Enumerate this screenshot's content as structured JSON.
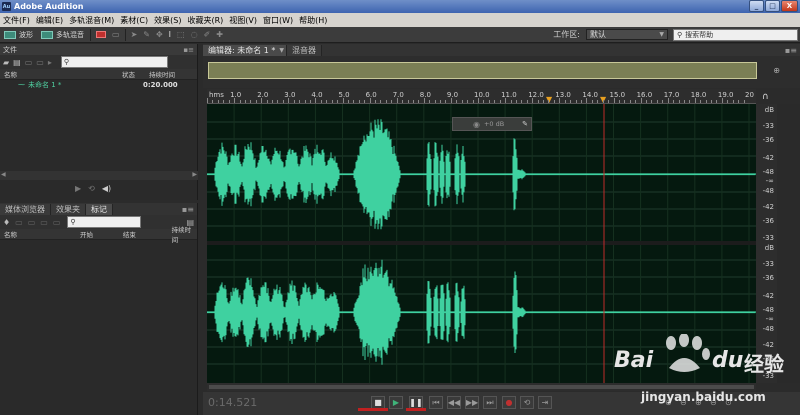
{
  "titlebar": {
    "title": "Adobe Audition",
    "logo": "Au"
  },
  "window_controls": {
    "minimize": "_",
    "maximize": "□",
    "close": "X"
  },
  "menu": [
    "文件(F)",
    "编辑(E)",
    "多轨混音(M)",
    "素材(C)",
    "效果(S)",
    "收藏夹(R)",
    "视图(V)",
    "窗口(W)",
    "帮助(H)"
  ],
  "toolbar": {
    "waveform_label": "波形",
    "multitrack_label": "多轨混音",
    "workspace_label": "工作区:",
    "workspace_value": "默认",
    "search_placeholder": "搜索帮助"
  },
  "files_panel": {
    "title": "文件",
    "columns": [
      "名称",
      "状态",
      "持续时间"
    ],
    "rows": [
      {
        "name": "未命名 1 *",
        "duration": "0:20.000"
      }
    ]
  },
  "markers_panel": {
    "tabs": [
      "媒体浏览器",
      "效果夹",
      "标记"
    ],
    "active_tab": "标记",
    "columns": [
      "名称",
      "开始",
      "结束",
      "持续时间"
    ]
  },
  "editor": {
    "tabs": [
      "编辑器: 未命名 1 *",
      "混音器"
    ],
    "active_tab": "编辑器: 未命名 1 *",
    "ruler_unit": "hms",
    "ruler_ticks": [
      "1.0",
      "2.0",
      "3.0",
      "4.0",
      "5.0",
      "6.0",
      "7.0",
      "8.0",
      "9.0",
      "10.0",
      "11.0",
      "12.0",
      "13.0",
      "14.0",
      "15.0",
      "16.0",
      "17.0",
      "18.0",
      "19.0",
      "20"
    ],
    "hud_value": "+0 dB",
    "db_labels_top": [
      "dB",
      "-33",
      "-36",
      "-42",
      "-48",
      "-∞",
      "-48",
      "-42",
      "-36",
      "-33"
    ],
    "db_labels_bottom": [
      "dB",
      "-33",
      "-36",
      "-42",
      "-48",
      "-∞",
      "-48",
      "-42",
      "-36",
      "-33"
    ],
    "current_time": "0:14.521",
    "colors": {
      "waveform": "#3fd1a0",
      "background": "#05190f",
      "playhead": "#c02a2a",
      "marker": "#e8a020"
    }
  },
  "watermark": {
    "brand": "Bai",
    "brand2": "du",
    "product": "经验",
    "url": "jingyan.baidu.com"
  }
}
